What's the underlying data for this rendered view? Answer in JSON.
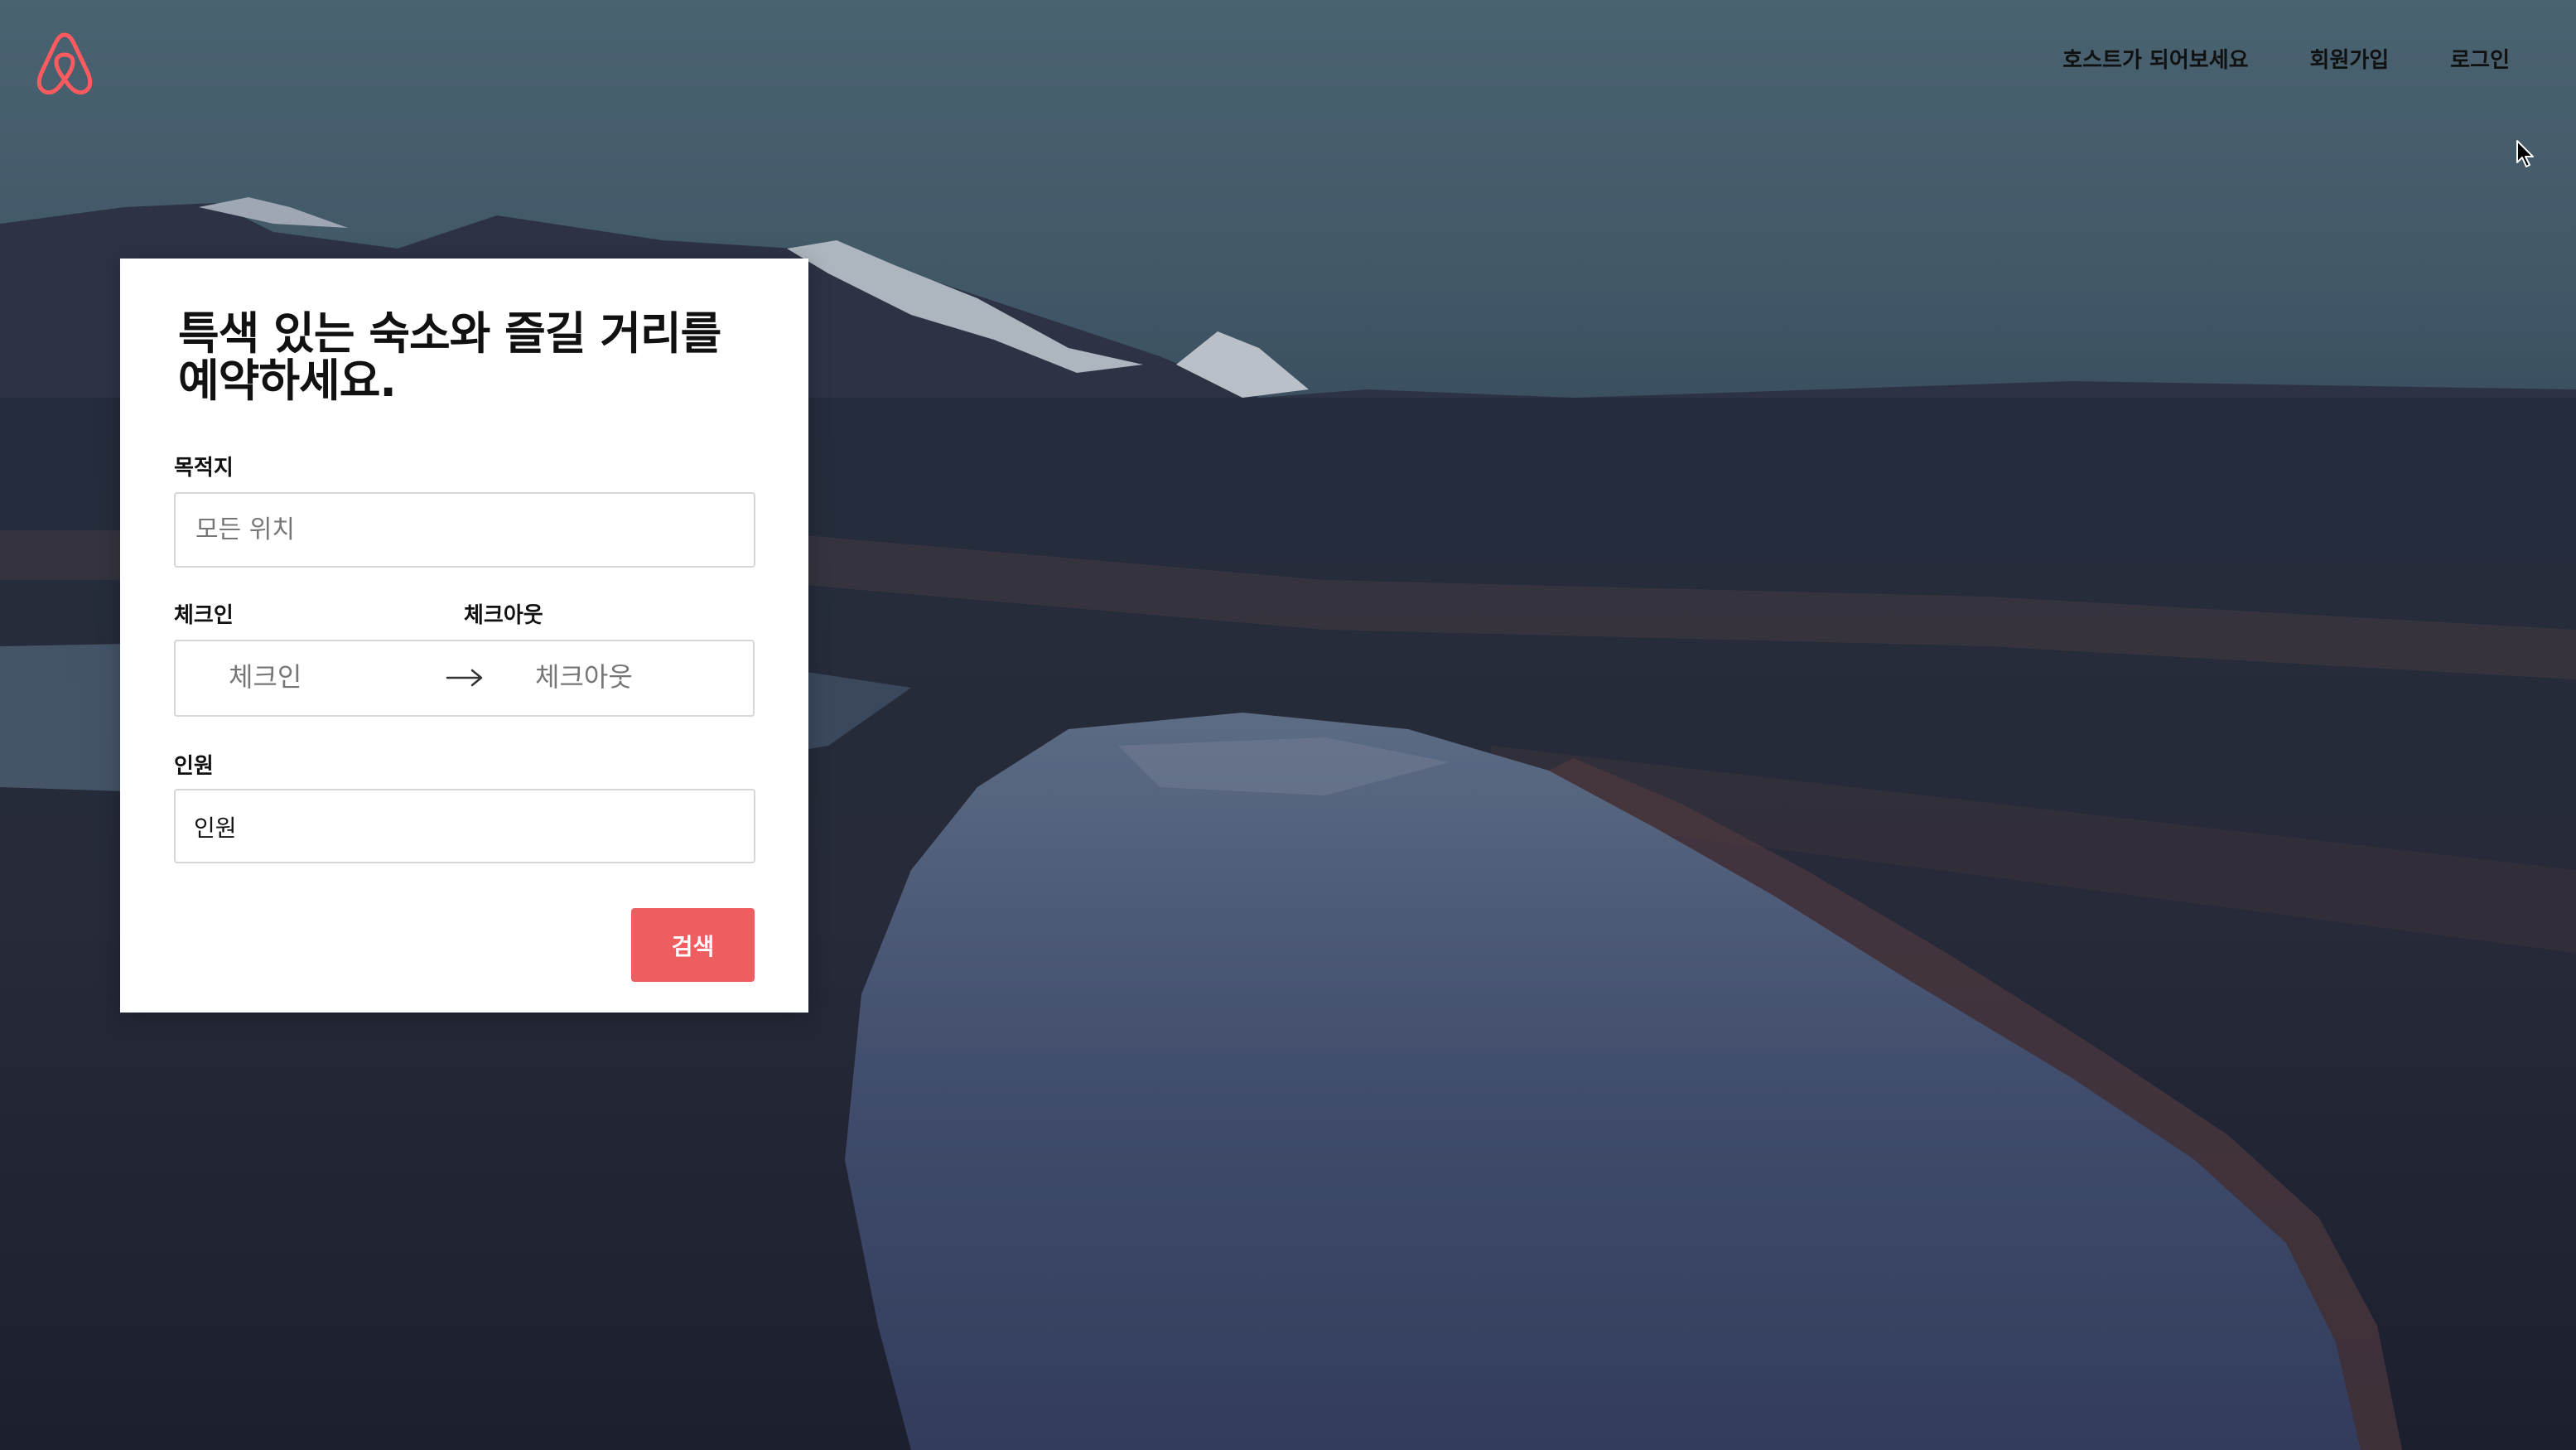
{
  "nav": {
    "host_label": "호스트가 되어보세요",
    "signup_label": "회원가입",
    "login_label": "로그인"
  },
  "search_card": {
    "headline": "특색 있는 숙소와 즐길 거리를 예약하세요.",
    "destination": {
      "label": "목적지",
      "placeholder": "모든 위치"
    },
    "checkin": {
      "label": "체크인",
      "placeholder": "체크인"
    },
    "checkout": {
      "label": "체크아웃",
      "placeholder": "체크아웃"
    },
    "guests": {
      "label": "인원",
      "value": "인원"
    },
    "search_button": "검색"
  },
  "colors": {
    "brand": "#ff5a5f",
    "button": "#ee5d5f"
  }
}
